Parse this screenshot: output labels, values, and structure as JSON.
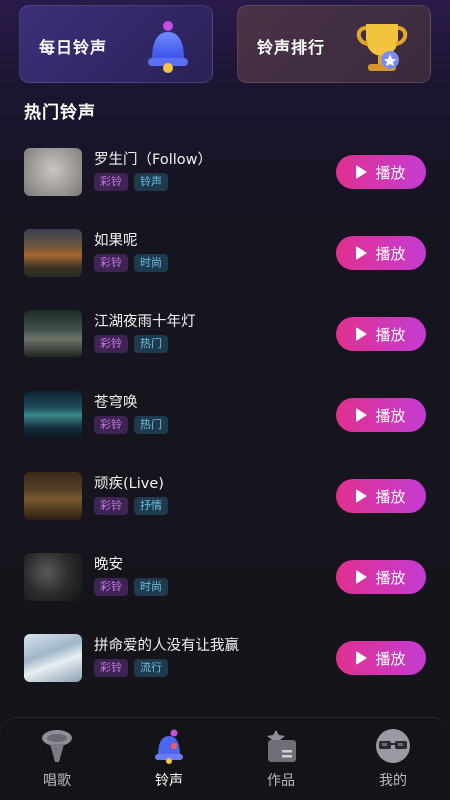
{
  "top_cards": {
    "daily": {
      "label": "每日铃声"
    },
    "rank": {
      "label": "铃声排行"
    }
  },
  "section": {
    "title": "热门铃声"
  },
  "songs": [
    {
      "title": "罗生门（Follow）",
      "tags": [
        "彩铃",
        "铃声"
      ],
      "play": "播放"
    },
    {
      "title": "如果呢",
      "tags": [
        "彩铃",
        "时尚"
      ],
      "play": "播放"
    },
    {
      "title": "江湖夜雨十年灯",
      "tags": [
        "彩铃",
        "热门"
      ],
      "play": "播放"
    },
    {
      "title": "苍穹唤",
      "tags": [
        "彩铃",
        "热门"
      ],
      "play": "播放"
    },
    {
      "title": "顽疾(Live)",
      "tags": [
        "彩铃",
        "抒情"
      ],
      "play": "播放"
    },
    {
      "title": "晚安",
      "tags": [
        "彩铃",
        "时尚"
      ],
      "play": "播放"
    },
    {
      "title": "拼命爱的人没有让我赢",
      "tags": [
        "彩铃",
        "流行"
      ],
      "play": "播放"
    }
  ],
  "tabbar": {
    "items": [
      {
        "label": "唱歌",
        "icon": "microphone-icon"
      },
      {
        "label": "铃声",
        "icon": "bell-icon",
        "active": true
      },
      {
        "label": "作品",
        "icon": "works-icon"
      },
      {
        "label": "我的",
        "icon": "profile-icon"
      }
    ]
  },
  "colors": {
    "play_gradient_start": "#e0308f",
    "play_gradient_end": "#c43cd2",
    "tag_primary": "#c676e4",
    "tag_secondary": "#6cc0e8"
  }
}
